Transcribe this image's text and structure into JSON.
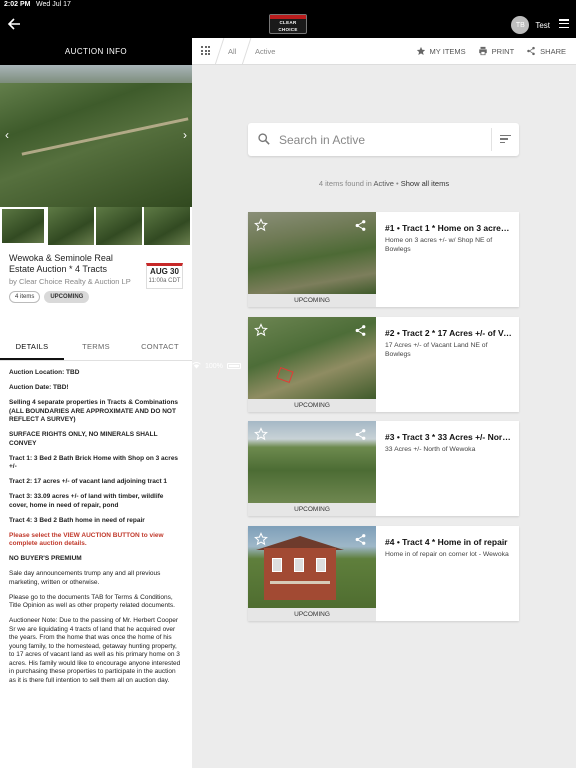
{
  "status_bar": {
    "time": "2:02 PM",
    "date": "Wed Jul 17",
    "battery": "100%"
  },
  "app_bar": {
    "logo_text": "CLEAR CHOICE",
    "user_initials": "TB",
    "user_name": "Test"
  },
  "left_panel": {
    "header": "AUCTION INFO",
    "title": "Wewoka & Seminole Real Estate Auction * 4 Tracts",
    "by_line": "by Clear Choice Realty & Auction LP",
    "items_chip": "4 items",
    "status_chip": "UPCOMING",
    "date_badge": {
      "date": "AUG 30",
      "time": "11:00a CDT"
    },
    "tabs": [
      {
        "label": "DETAILS"
      },
      {
        "label": "TERMS"
      },
      {
        "label": "CONTACT"
      }
    ],
    "details": [
      "Auction Location: TBD",
      "Auction Date: TBD!",
      "Selling 4 separate properties in Tracts & Combinations (ALL BOUNDARIES ARE APPROXIMATE AND DO NOT REFLECT A SURVEY)",
      "SURFACE RIGHTS ONLY, NO MINERALS SHALL CONVEY",
      "Tract 1: 3 Bed 2 Bath Brick Home with Shop on 3 acres +/-",
      "Tract 2: 17 acres +/- of vacant land adjoining tract 1",
      "Tract 3: 33.09 acres +/- of land with timber, wildlife cover, home in need of repair, pond",
      "Tract 4: 3 Bed 2 Bath home in need of repair",
      "Please select the VIEW AUCTION BUTTON to view complete auction details.",
      "NO BUYER'S PREMIUM",
      "Sale day announcements trump any and all previous marketing, written or otherwise.",
      "Please go to the documents TAB for Terms & Conditions, Title Opinion as well as other property related documents.",
      "Auctioneer Note: Due to the passing of Mr. Herbert Cooper Sr we are liquidating 4 tracts of land that he acquired over the years.  From the home that was once the home of his young family, to the homestead, getaway hunting property, to 17 acres of vacant land as well as his primary home on 3 acres.  His family would like to encourage anyone interested in purchasing these properties to participate in the auction as it is there full intention to sell them all on auction day."
    ]
  },
  "right_panel": {
    "breadcrumb": {
      "root": "All",
      "current": "Active"
    },
    "actions": {
      "my_items": "MY ITEMS",
      "print": "PRINT",
      "share": "SHARE"
    },
    "search": {
      "placeholder": "Search in Active"
    },
    "found": {
      "count_text": "4 items found in",
      "scope": "Active",
      "separator": " • ",
      "show_all": "Show all items"
    },
    "items": [
      {
        "title": "#1 • Tract 1 * Home on 3 acres +/-",
        "description": "Home on 3 acres +/- w/ Shop NE of Bowlegs",
        "status": "UPCOMING"
      },
      {
        "title": "#2 • Tract 2 * 17 Acres +/- of Vacant Land",
        "description": "17 Acres +/- of Vacant Land NE of Bowlegs",
        "status": "UPCOMING"
      },
      {
        "title": "#3 • Tract 3 * 33 Acres +/- North of Wewoka",
        "description": "33 Acres +/- North of Wewoka",
        "status": "UPCOMING"
      },
      {
        "title": "#4 • Tract 4 * Home in of repair",
        "description": "Home in of repair on corner lot - Wewoka",
        "status": "UPCOMING"
      }
    ]
  },
  "icons": [
    "back-arrow-icon",
    "menu-icon",
    "chevron-left-icon",
    "chevron-right-icon",
    "grid-icon",
    "star-icon",
    "print-icon",
    "share-icon",
    "search-icon",
    "filter-icon"
  ],
  "colors": {
    "accent_red": "#c62828",
    "app_bar": "#000000",
    "background": "#ececec"
  }
}
